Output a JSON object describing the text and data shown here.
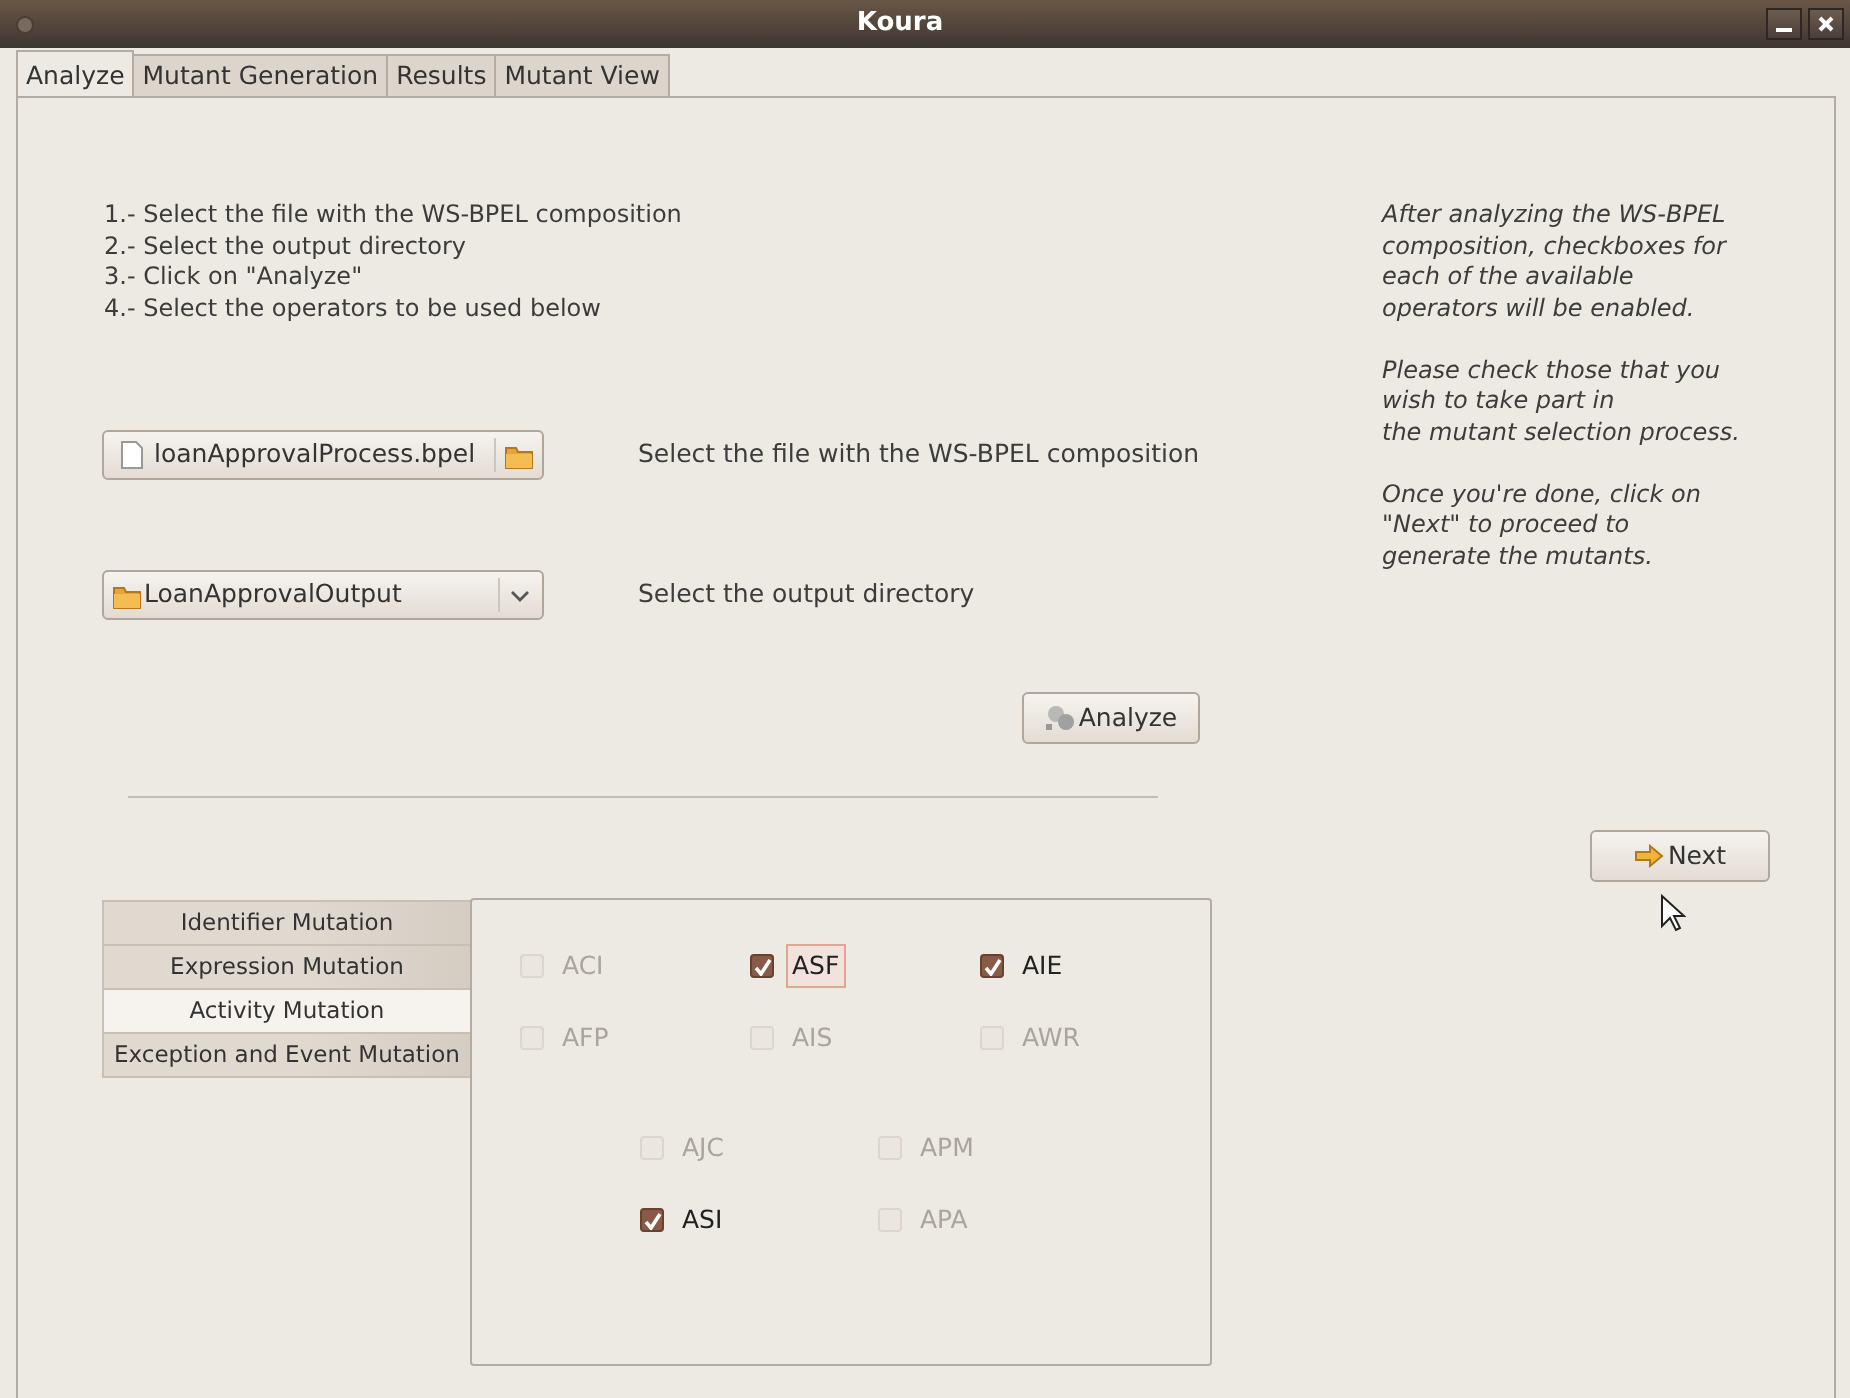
{
  "window": {
    "title": "Koura"
  },
  "tabs": [
    {
      "label": "Analyze",
      "selected": true
    },
    {
      "label": "Mutant Generation",
      "selected": false
    },
    {
      "label": "Results",
      "selected": false
    },
    {
      "label": "Mutant View",
      "selected": false
    }
  ],
  "instructions": [
    "1.- Select the file with the WS-BPEL composition",
    "2.- Select the output directory",
    "3.- Click on \"Analyze\"",
    "4.- Select the operators to be used below"
  ],
  "file_chooser": {
    "value": "loanApprovalProcess.bpel",
    "label": "Select the file with the WS-BPEL composition"
  },
  "directory_chooser": {
    "value": "LoanApprovalOutput",
    "label": "Select the output directory"
  },
  "analyze_button": "Analyze",
  "help_paragraphs": [
    [
      "After analyzing the WS-BPEL",
      "composition, checkboxes for",
      "each of the available",
      "operators will be enabled."
    ],
    [
      "Please check those that you",
      "wish to take part in",
      "the mutant selection process."
    ],
    [
      "Once you're done, click on",
      "\"Next\" to proceed to",
      "generate the mutants."
    ]
  ],
  "next_button": "Next",
  "operator_tabs": [
    {
      "label": "Identifier Mutation",
      "selected": false
    },
    {
      "label": "Expression Mutation",
      "selected": false
    },
    {
      "label": "Activity Mutation",
      "selected": true
    },
    {
      "label": "Exception and Event Mutation",
      "selected": false
    }
  ],
  "operator_groups": [
    {
      "rows": [
        [
          {
            "label": "ACI",
            "checked": false,
            "disabled": true,
            "focused": false
          },
          {
            "label": "ASF",
            "checked": true,
            "disabled": false,
            "focused": true
          },
          {
            "label": "AIE",
            "checked": true,
            "disabled": false,
            "focused": false
          }
        ],
        [
          {
            "label": "AFP",
            "checked": false,
            "disabled": true,
            "focused": false
          },
          {
            "label": "AIS",
            "checked": false,
            "disabled": true,
            "focused": false
          },
          {
            "label": "AWR",
            "checked": false,
            "disabled": true,
            "focused": false
          }
        ]
      ]
    },
    {
      "rows": [
        [
          {
            "label": "AJC",
            "checked": false,
            "disabled": true,
            "focused": false
          },
          {
            "label": "APM",
            "checked": false,
            "disabled": true,
            "focused": false
          }
        ],
        [
          {
            "label": "ASI",
            "checked": true,
            "disabled": false,
            "focused": false
          },
          {
            "label": "APA",
            "checked": false,
            "disabled": true,
            "focused": false
          }
        ]
      ]
    }
  ]
}
